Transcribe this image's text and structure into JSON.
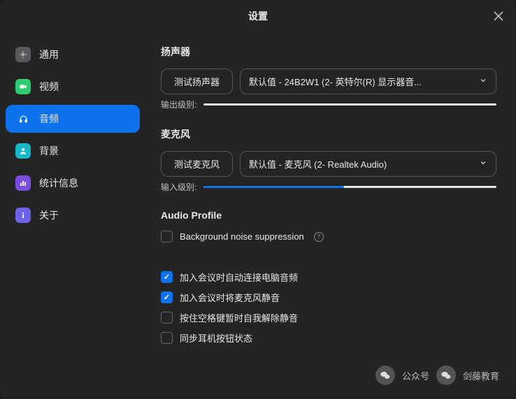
{
  "title": "设置",
  "sidebar": {
    "items": [
      {
        "label": "通用"
      },
      {
        "label": "视频"
      },
      {
        "label": "音频"
      },
      {
        "label": "背景"
      },
      {
        "label": "统计信息"
      },
      {
        "label": "关于"
      }
    ]
  },
  "speaker": {
    "heading": "扬声器",
    "test_btn": "测试扬声器",
    "selected": "默认值 - 24B2W1 (2- 英特尔(R) 显示器音...",
    "level_label": "输出级别:",
    "level_pct": "0%"
  },
  "mic": {
    "heading": "麦克风",
    "test_btn": "测试麦克风",
    "selected": "默认值 - 麦克风 (2- Realtek Audio)",
    "level_label": "输入级别:",
    "level_pct": "48%"
  },
  "audio_profile": {
    "heading": "Audio Profile",
    "noise_suppression": "Background noise suppression"
  },
  "options": {
    "auto_connect_audio": "加入会议时自动连接电脑音频",
    "mute_mic_on_join": "加入会议时将麦克风静音",
    "spacebar_unmute": "按住空格键暂时自我解除静音",
    "sync_headset_button": "同步耳机按钮状态"
  },
  "watermark": {
    "label1": "公众号",
    "label2": "剑藤教育"
  }
}
